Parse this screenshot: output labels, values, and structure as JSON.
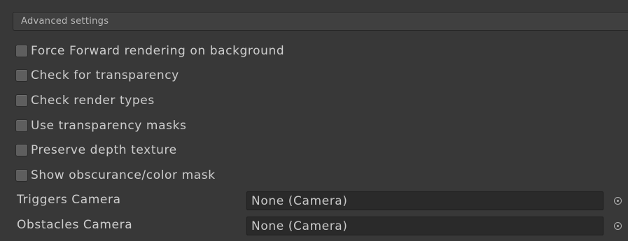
{
  "section": {
    "title": "Advanced settings"
  },
  "toggles": [
    {
      "label": "Force Forward rendering on background",
      "checked": false
    },
    {
      "label": "Check for transparency",
      "checked": false
    },
    {
      "label": "Check render types",
      "checked": false
    },
    {
      "label": "Use transparency masks",
      "checked": false
    },
    {
      "label": "Preserve depth texture",
      "checked": false
    },
    {
      "label": "Show obscurance/color mask",
      "checked": false
    }
  ],
  "fields": [
    {
      "label": "Triggers Camera",
      "value": "None (Camera)",
      "picker_icon": "object-picker-icon"
    },
    {
      "label": "Obstacles Camera",
      "value": "None (Camera)",
      "picker_icon": "object-picker-icon"
    }
  ]
}
